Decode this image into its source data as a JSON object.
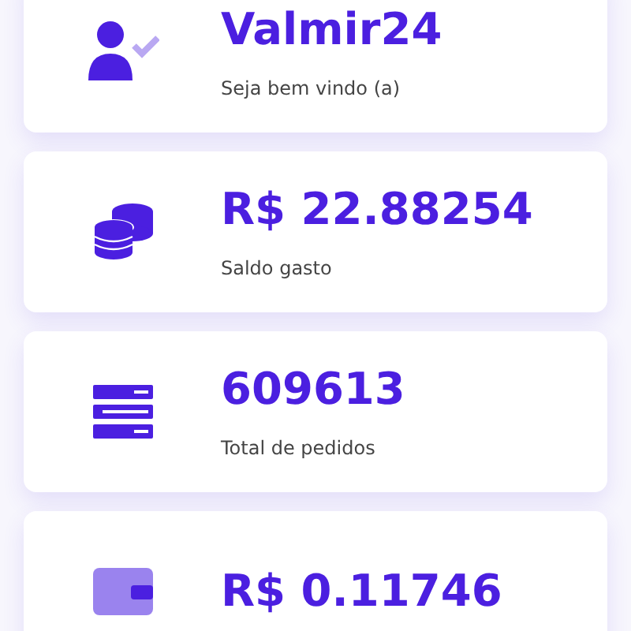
{
  "cards": [
    {
      "value": "Valmir24",
      "label": "Seja bem vindo (a)"
    },
    {
      "value": "R$ 22.88254",
      "label": "Saldo gasto"
    },
    {
      "value": "609613",
      "label": "Total de pedidos"
    },
    {
      "value": "R$ 0.11746"
    }
  ]
}
